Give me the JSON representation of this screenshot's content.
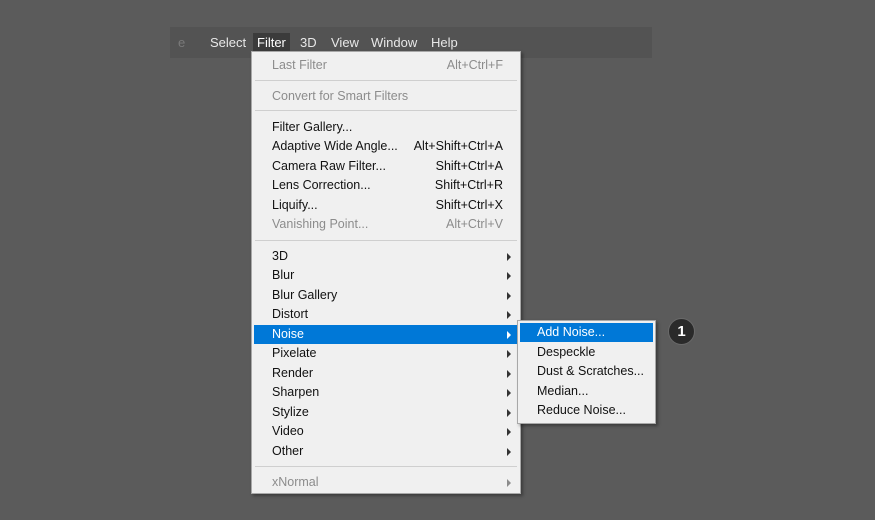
{
  "menubar": {
    "items": [
      "e",
      "Select",
      "Filter",
      "3D",
      "View",
      "Window",
      "Help"
    ]
  },
  "filter_menu": {
    "last_filter": {
      "label": "Last Filter",
      "shortcut": "Alt+Ctrl+F"
    },
    "convert_smart": {
      "label": "Convert for Smart Filters"
    },
    "filter_gallery": {
      "label": "Filter Gallery..."
    },
    "adaptive_wide": {
      "label": "Adaptive Wide Angle...",
      "shortcut": "Alt+Shift+Ctrl+A"
    },
    "camera_raw": {
      "label": "Camera Raw Filter...",
      "shortcut": "Shift+Ctrl+A"
    },
    "lens_correction": {
      "label": "Lens Correction...",
      "shortcut": "Shift+Ctrl+R"
    },
    "liquify": {
      "label": "Liquify...",
      "shortcut": "Shift+Ctrl+X"
    },
    "vanishing_point": {
      "label": "Vanishing Point...",
      "shortcut": "Alt+Ctrl+V"
    },
    "submenus": [
      "3D",
      "Blur",
      "Blur Gallery",
      "Distort",
      "Noise",
      "Pixelate",
      "Render",
      "Sharpen",
      "Stylize",
      "Video",
      "Other"
    ],
    "xnormal": {
      "label": "xNormal"
    }
  },
  "noise_submenu": {
    "items": [
      "Add Noise...",
      "Despeckle",
      "Dust & Scratches...",
      "Median...",
      "Reduce Noise..."
    ]
  },
  "callout": {
    "number": "1"
  },
  "colors": {
    "highlight": "#0078d7",
    "menu_bg": "#f0f0f0",
    "canvas": "#5b5b5b"
  }
}
